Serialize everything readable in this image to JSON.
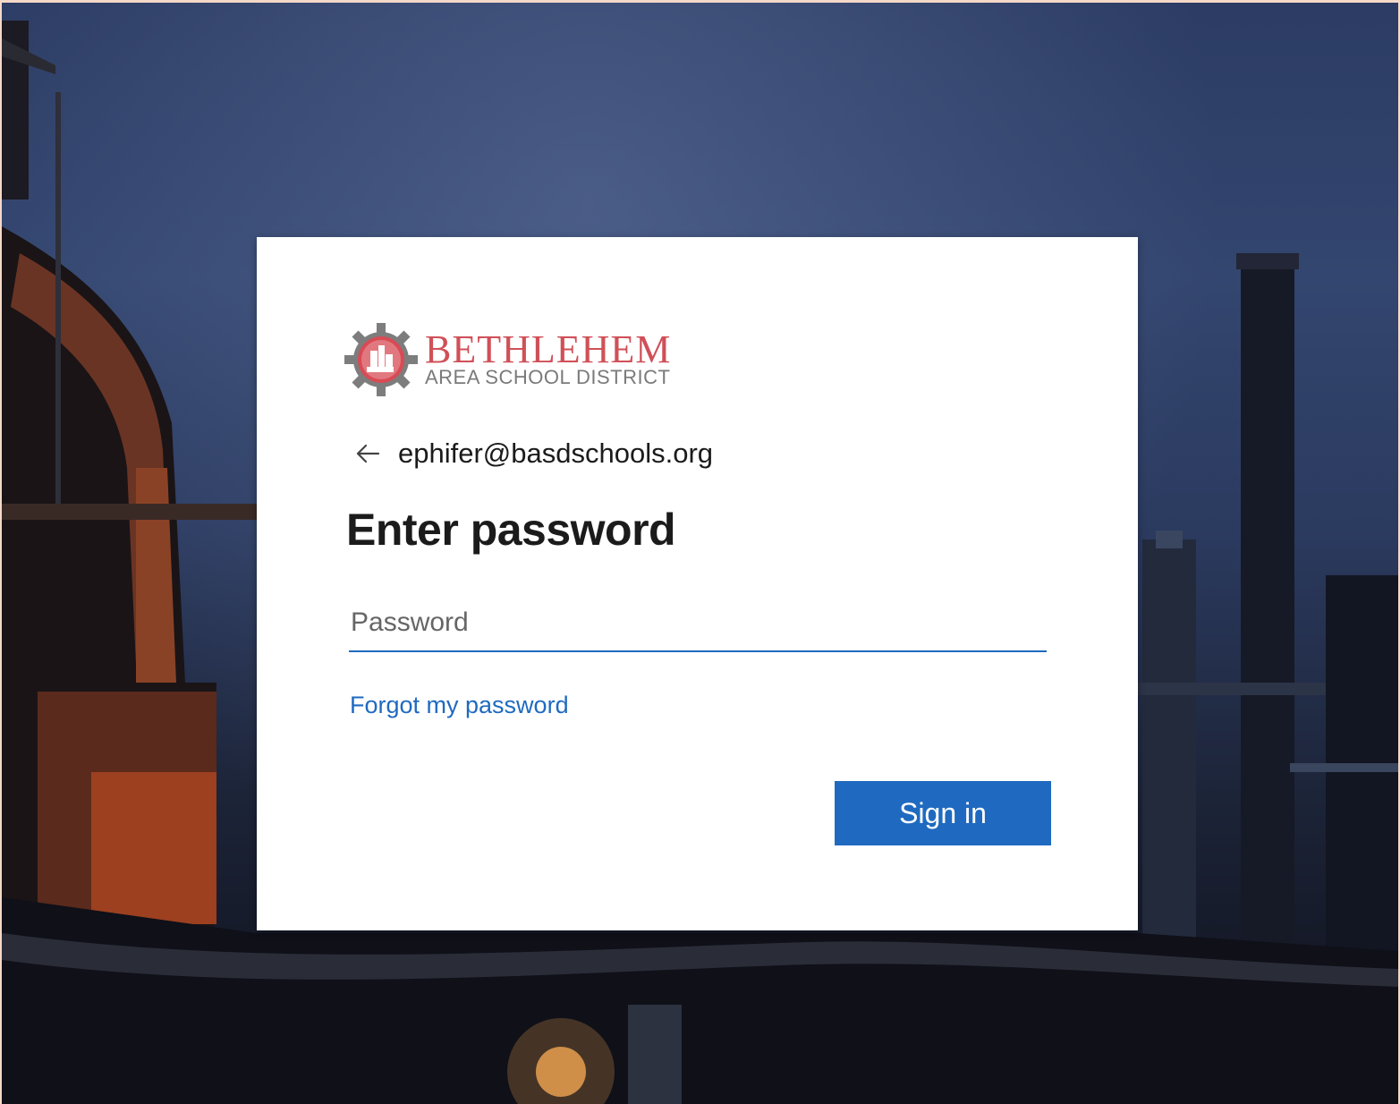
{
  "logo": {
    "name": "BETHLEHEM",
    "subtitle": "AREA SCHOOL DISTRICT",
    "icon": "bethlehem-gear-logo-icon"
  },
  "identity": {
    "back_icon": "arrow-left-icon",
    "email": "ephifer@basdschools.org"
  },
  "title": "Enter password",
  "password": {
    "placeholder": "Password",
    "value": ""
  },
  "links": {
    "forgot_password": "Forgot my password"
  },
  "buttons": {
    "sign_in": "Sign in"
  },
  "colors": {
    "accent": "#1f6ac0",
    "logo_red": "#d05058",
    "logo_gray": "#7a7a7a",
    "card_bg": "#ffffff"
  }
}
